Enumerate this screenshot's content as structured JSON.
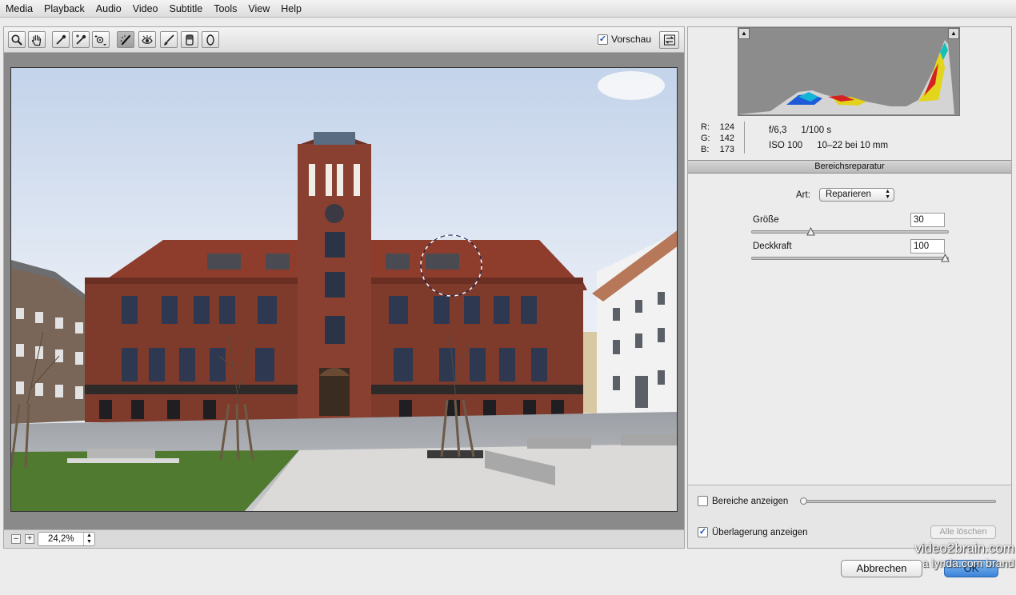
{
  "menu": [
    "Media",
    "Playback",
    "Audio",
    "Video",
    "Subtitle",
    "Tools",
    "View",
    "Help"
  ],
  "toolbar": {
    "tools": [
      "zoom-icon",
      "hand-icon",
      "eyedropper-icon",
      "color-sampler-icon",
      "target-adjust-icon",
      "spot-healing-icon",
      "red-eye-icon",
      "adjustment-brush-icon",
      "graduated-filter-icon",
      "radial-filter-icon"
    ],
    "preview_label": "Vorschau",
    "preview_checked": true
  },
  "status": {
    "zoom_value": "24,2%",
    "zoom_minus": "–",
    "zoom_plus": "+"
  },
  "info": {
    "r_label": "R:",
    "r_value": "124",
    "g_label": "G:",
    "g_value": "142",
    "b_label": "B:",
    "b_value": "173",
    "aperture": "f/6,3",
    "shutter": "1/100 s",
    "iso": "ISO 100",
    "lens": "10–22 bei 10 mm"
  },
  "panel": {
    "title": "Bereichsreparatur",
    "art_label": "Art:",
    "art_value": "Reparieren",
    "size_label": "Größe",
    "size_value": "30",
    "size_fraction": 0.29,
    "opacity_label": "Deckkraft",
    "opacity_value": "100",
    "opacity_fraction": 1.0,
    "show_areas_label": "Bereiche anzeigen",
    "show_areas_checked": false,
    "overlay_label": "Überlagerung anzeigen",
    "overlay_checked": true,
    "clear_all_label": "Alle löschen"
  },
  "dialog": {
    "cancel_label": "Abbrechen",
    "ok_label": "OK"
  },
  "watermark": {
    "line1": "video2brain.com",
    "line2": "a lynda.com brand"
  }
}
